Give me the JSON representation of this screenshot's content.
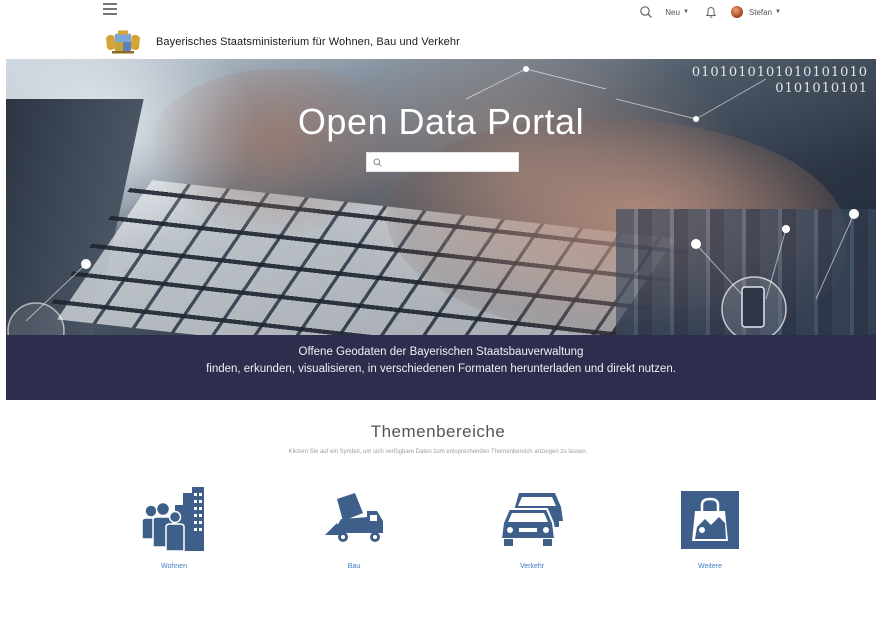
{
  "topbar": {
    "new_label": "Neu",
    "user_name": "Stefan"
  },
  "brand": {
    "title": "Bayerisches Staatsministerium für Wohnen, Bau und Verkehr"
  },
  "hero": {
    "title": "Open Data Portal",
    "search_placeholder": "",
    "binary_line1": "0101010101010101010",
    "binary_line2": "0101010101"
  },
  "banner": {
    "line1": "Offene Geodaten der Bayerischen Staatsbauverwaltung",
    "line2": "finden, erkunden, visualisieren, in verschiedenen Formaten herunterladen und direkt nutzen."
  },
  "themen": {
    "title": "Themenbereiche",
    "subtitle": "Klicken Sie auf ein Symbol, um sich verfügbare Daten zum entsprechenden Themenbereich anzeigen zu lassen.",
    "tiles": [
      {
        "label": "Wohnen",
        "icon": "housing-people-icon"
      },
      {
        "label": "Bau",
        "icon": "construction-truck-icon"
      },
      {
        "label": "Verkehr",
        "icon": "traffic-cars-icon"
      },
      {
        "label": "Weitere",
        "icon": "more-map-bag-icon"
      }
    ]
  },
  "colors": {
    "banner_bg": "#2e2d4e",
    "icon_blue": "#3e5f8a",
    "link_blue": "#3b7fc4"
  }
}
